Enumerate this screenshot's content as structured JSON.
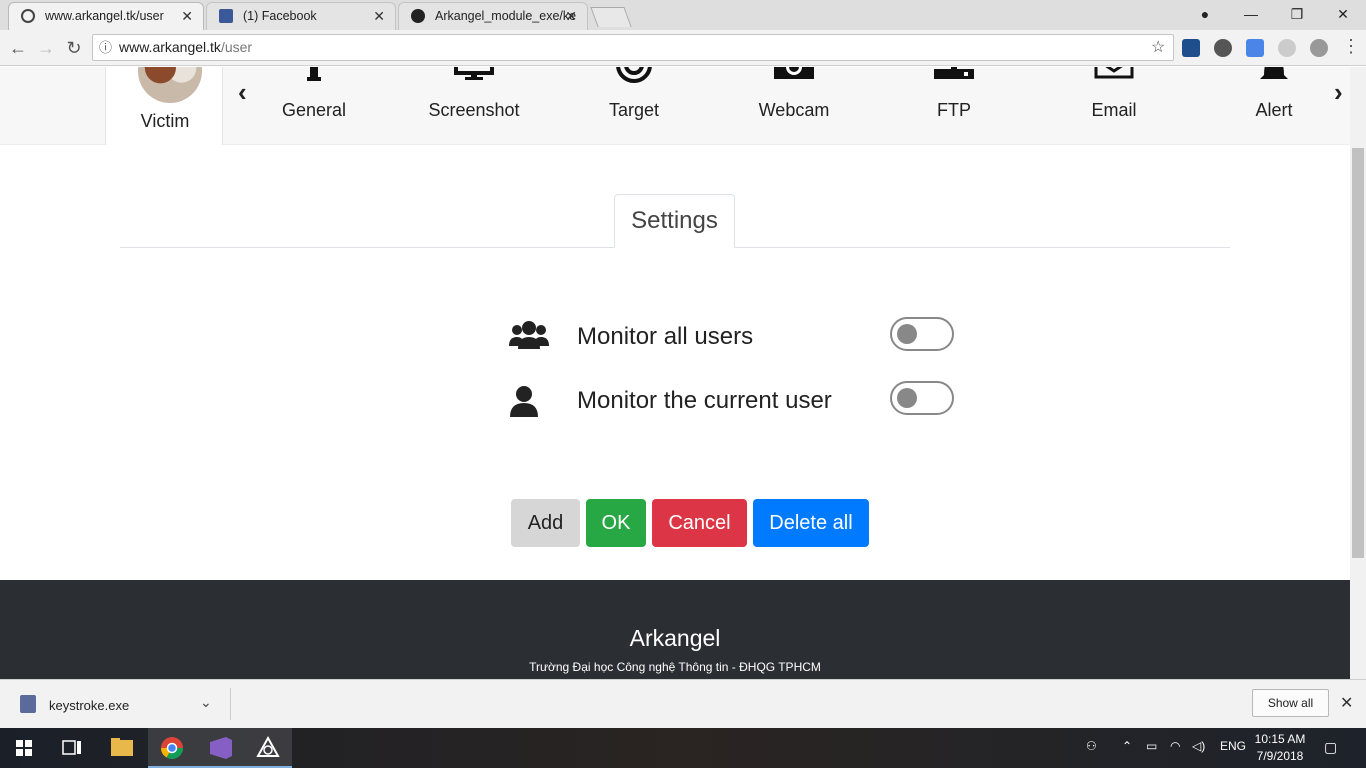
{
  "browser": {
    "tabs": [
      {
        "title": "www.arkangel.tk/user",
        "active": true
      },
      {
        "title": "(1) Facebook",
        "active": false
      },
      {
        "title": "Arkangel_module_exe/ke",
        "active": false
      }
    ],
    "url_host": "www.arkangel.tk",
    "url_path": "/user"
  },
  "topnav": {
    "victim_label": "Victim",
    "items": [
      "General",
      "Screenshot",
      "Target",
      "Webcam",
      "FTP",
      "Email",
      "Alert"
    ]
  },
  "settings": {
    "tab_label": "Settings",
    "options": [
      {
        "label": "Monitor all users",
        "enabled": false
      },
      {
        "label": "Monitor the current user",
        "enabled": false
      }
    ],
    "buttons": {
      "add": "Add",
      "ok": "OK",
      "cancel": "Cancel",
      "delete_all": "Delete all"
    }
  },
  "footer": {
    "title": "Arkangel",
    "subtitle": "Trường Đại học Công nghệ Thông tin - ĐHQG TPHCM"
  },
  "downloads": {
    "file_name": "keystroke.exe",
    "show_all": "Show all"
  },
  "taskbar": {
    "language": "ENG",
    "time": "10:15 AM",
    "date": "7/9/2018"
  },
  "colors": {
    "ok": "#28a745",
    "cancel": "#dc3545",
    "delete_all": "#007bff",
    "add": "#d6d6d6",
    "footer": "#2b2e33"
  }
}
